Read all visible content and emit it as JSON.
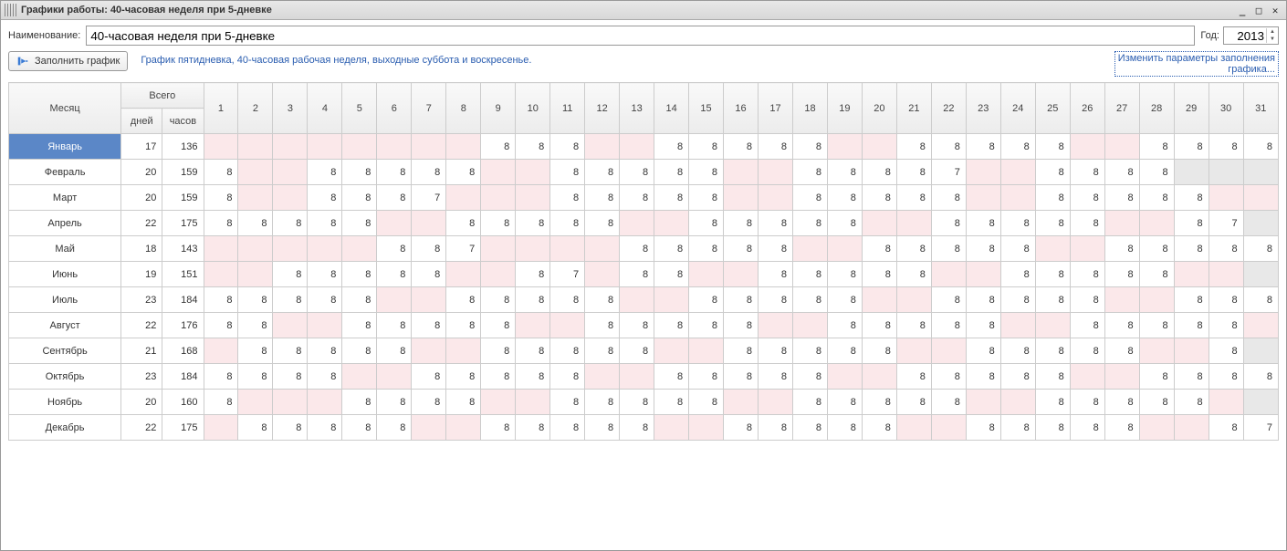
{
  "window": {
    "title": "Графики работы: 40-часовая неделя при 5-дневке"
  },
  "form": {
    "name_label": "Наименование:",
    "name_value": "40-часовая неделя при 5-дневке",
    "year_label": "Год:",
    "year_value": "2013",
    "fill_button": "Заполнить график",
    "description": "График пятидневка, 40-часовая рабочая неделя, выходные суббота и воскресенье.",
    "change_params_line1": "Изменить параметры заполнения",
    "change_params_line2": "графика..."
  },
  "headers": {
    "month": "Месяц",
    "total": "Всего",
    "days": "дней",
    "hours": "часов"
  },
  "day_numbers": [
    "1",
    "2",
    "3",
    "4",
    "5",
    "6",
    "7",
    "8",
    "9",
    "10",
    "11",
    "12",
    "13",
    "14",
    "15",
    "16",
    "17",
    "18",
    "19",
    "20",
    "21",
    "22",
    "23",
    "24",
    "25",
    "26",
    "27",
    "28",
    "29",
    "30",
    "31"
  ],
  "selected_month_index": 0,
  "months": [
    {
      "name": "Январь",
      "days": 17,
      "hours": 136,
      "length": 31,
      "first_weekday": 2,
      "holidays": [
        1,
        2,
        3,
        4,
        5,
        6,
        7,
        8
      ],
      "cells": [
        "",
        "",
        "",
        "",
        "",
        "",
        "",
        "",
        "8",
        "8",
        "8",
        "",
        "",
        "8",
        "8",
        "8",
        "8",
        "8",
        "",
        "",
        "8",
        "8",
        "8",
        "8",
        "8",
        "",
        "",
        "8",
        "8",
        "8",
        "8"
      ]
    },
    {
      "name": "Февраль",
      "days": 20,
      "hours": 159,
      "length": 28,
      "first_weekday": 5,
      "holidays": [],
      "cells": [
        "8",
        "",
        "",
        "8",
        "8",
        "8",
        "8",
        "8",
        "",
        "",
        "8",
        "8",
        "8",
        "8",
        "8",
        "",
        "",
        "8",
        "8",
        "8",
        "8",
        "7",
        "",
        "",
        "8",
        "8",
        "8",
        "8"
      ]
    },
    {
      "name": "Март",
      "days": 20,
      "hours": 159,
      "length": 31,
      "first_weekday": 5,
      "holidays": [
        8
      ],
      "cells": [
        "8",
        "",
        "",
        "8",
        "8",
        "8",
        "7",
        "",
        "",
        "",
        "8",
        "8",
        "8",
        "8",
        "8",
        "",
        "",
        "8",
        "8",
        "8",
        "8",
        "8",
        "",
        "",
        "8",
        "8",
        "8",
        "8",
        "8",
        "",
        ""
      ]
    },
    {
      "name": "Апрель",
      "days": 22,
      "hours": 175,
      "length": 30,
      "first_weekday": 1,
      "holidays": [],
      "cells": [
        "8",
        "8",
        "8",
        "8",
        "8",
        "",
        "",
        "8",
        "8",
        "8",
        "8",
        "8",
        "",
        "",
        "8",
        "8",
        "8",
        "8",
        "8",
        "",
        "",
        "8",
        "8",
        "8",
        "8",
        "8",
        "",
        "",
        "8",
        "7"
      ]
    },
    {
      "name": "Май",
      "days": 18,
      "hours": 143,
      "length": 31,
      "first_weekday": 3,
      "holidays": [
        1,
        2,
        3,
        9,
        10
      ],
      "cells": [
        "",
        "",
        "",
        "",
        "",
        "8",
        "8",
        "7",
        "",
        "",
        "",
        "",
        "8",
        "8",
        "8",
        "8",
        "8",
        "",
        "",
        "8",
        "8",
        "8",
        "8",
        "8",
        "",
        "",
        "8",
        "8",
        "8",
        "8",
        "8"
      ]
    },
    {
      "name": "Июнь",
      "days": 19,
      "hours": 151,
      "length": 30,
      "first_weekday": 6,
      "holidays": [
        12
      ],
      "cells": [
        "",
        "",
        "8",
        "8",
        "8",
        "8",
        "8",
        "",
        "",
        "8",
        "7",
        "",
        "8",
        "8",
        "",
        "",
        "8",
        "8",
        "8",
        "8",
        "8",
        "",
        "",
        "8",
        "8",
        "8",
        "8",
        "8",
        "",
        ""
      ]
    },
    {
      "name": "Июль",
      "days": 23,
      "hours": 184,
      "length": 31,
      "first_weekday": 1,
      "holidays": [],
      "cells": [
        "8",
        "8",
        "8",
        "8",
        "8",
        "",
        "",
        "8",
        "8",
        "8",
        "8",
        "8",
        "",
        "",
        "8",
        "8",
        "8",
        "8",
        "8",
        "",
        "",
        "8",
        "8",
        "8",
        "8",
        "8",
        "",
        "",
        "8",
        "8",
        "8"
      ]
    },
    {
      "name": "Август",
      "days": 22,
      "hours": 176,
      "length": 31,
      "first_weekday": 4,
      "holidays": [],
      "cells": [
        "8",
        "8",
        "",
        "",
        "8",
        "8",
        "8",
        "8",
        "8",
        "",
        "",
        "8",
        "8",
        "8",
        "8",
        "8",
        "",
        "",
        "8",
        "8",
        "8",
        "8",
        "8",
        "",
        "",
        "8",
        "8",
        "8",
        "8",
        "8",
        ""
      ]
    },
    {
      "name": "Сентябрь",
      "days": 21,
      "hours": 168,
      "length": 30,
      "first_weekday": 7,
      "holidays": [],
      "cells": [
        "",
        "8",
        "8",
        "8",
        "8",
        "8",
        "",
        "",
        "8",
        "8",
        "8",
        "8",
        "8",
        "",
        "",
        "8",
        "8",
        "8",
        "8",
        "8",
        "",
        "",
        "8",
        "8",
        "8",
        "8",
        "8",
        "",
        "",
        "8"
      ]
    },
    {
      "name": "Октябрь",
      "days": 23,
      "hours": 184,
      "length": 31,
      "first_weekday": 2,
      "holidays": [],
      "cells": [
        "8",
        "8",
        "8",
        "8",
        "",
        "",
        "8",
        "8",
        "8",
        "8",
        "8",
        "",
        "",
        "8",
        "8",
        "8",
        "8",
        "8",
        "",
        "",
        "8",
        "8",
        "8",
        "8",
        "8",
        "",
        "",
        "8",
        "8",
        "8",
        "8"
      ]
    },
    {
      "name": "Ноябрь",
      "days": 20,
      "hours": 160,
      "length": 30,
      "first_weekday": 5,
      "holidays": [
        4
      ],
      "cells": [
        "8",
        "",
        "",
        "",
        "8",
        "8",
        "8",
        "8",
        "",
        "",
        "8",
        "8",
        "8",
        "8",
        "8",
        "",
        "",
        "8",
        "8",
        "8",
        "8",
        "8",
        "",
        "",
        "8",
        "8",
        "8",
        "8",
        "8",
        ""
      ]
    },
    {
      "name": "Декабрь",
      "days": 22,
      "hours": 175,
      "length": 31,
      "first_weekday": 7,
      "holidays": [],
      "cells": [
        "",
        "8",
        "8",
        "8",
        "8",
        "8",
        "",
        "",
        "8",
        "8",
        "8",
        "8",
        "8",
        "",
        "",
        "8",
        "8",
        "8",
        "8",
        "8",
        "",
        "",
        "8",
        "8",
        "8",
        "8",
        "8",
        "",
        "",
        "8",
        "7"
      ]
    }
  ]
}
